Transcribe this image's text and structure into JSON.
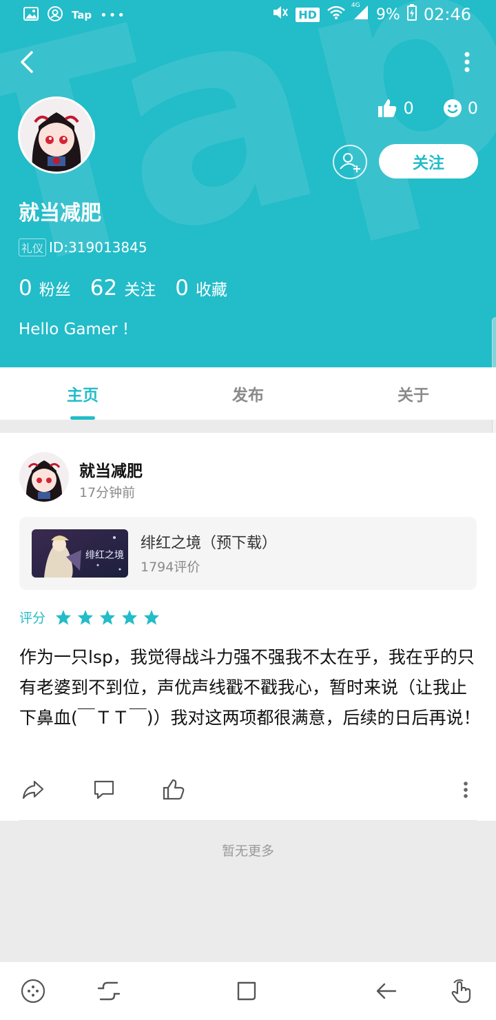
{
  "status_bar": {
    "app_label": "Tap",
    "network": "4G",
    "hd": "HD",
    "battery": "9%",
    "time": "02:46"
  },
  "header": {
    "watermark": "apTap",
    "likes": "0",
    "smiles": "0",
    "follow_label": "关注",
    "username": "就当减肥",
    "badge": "礼仪",
    "user_id": "ID:319013845",
    "counts": [
      {
        "num": "0",
        "label": "粉丝"
      },
      {
        "num": "62",
        "label": "关注"
      },
      {
        "num": "0",
        "label": "收藏"
      }
    ],
    "bio": "Hello Gamer !"
  },
  "tabs": [
    {
      "label": "主页",
      "active": true
    },
    {
      "label": "发布",
      "active": false
    },
    {
      "label": "关于",
      "active": false
    }
  ],
  "post": {
    "author": "就当减肥",
    "time": "17分钟前",
    "game": {
      "title": "绯红之境（预下载）",
      "reviews": "1794评价",
      "thumb_text": "绯红之境"
    },
    "rating_label": "评分",
    "rating": 5,
    "text": "作为一只lsp，我觉得战斗力强不强我不太在乎，我在乎的只有老婆到不到位，声优声线戳不戳我心，暂时来说（让我止下鼻血(￣ＴＴ￣)）我对这两项都很满意，后续的日后再说！"
  },
  "footer_text": "暂无更多",
  "colors": {
    "accent": "#23bcc9",
    "text": "#111111",
    "muted": "#8a8a8a",
    "background": "#ebebeb"
  },
  "icons": {
    "back": "chevron-left-icon",
    "more": "more-vertical-icon",
    "like": "thumbs-up-icon",
    "smile": "smile-icon",
    "add_friend": "add-user-icon",
    "share": "share-icon",
    "comment": "comment-icon",
    "star": "star-icon",
    "nav_game": "gamepad-icon",
    "nav_recent": "recent-apps-icon",
    "nav_home": "home-icon",
    "nav_back": "back-arrow-icon",
    "nav_touch": "touch-hand-icon"
  }
}
